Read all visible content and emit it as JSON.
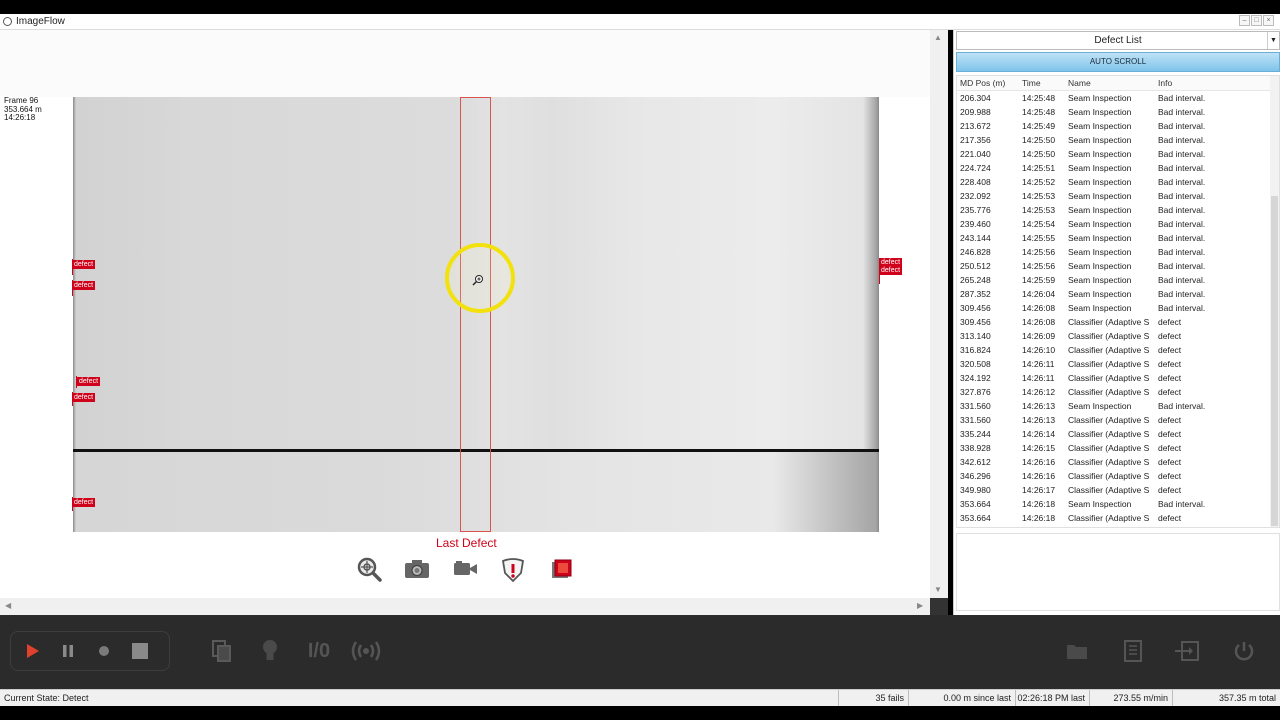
{
  "window": {
    "title": "ImageFlow"
  },
  "frame_info": {
    "frame": "Frame 96",
    "position": "353.664 m",
    "time": "14:26:18"
  },
  "image": {
    "defect_label": "defect",
    "last_defect_label": "Last Defect"
  },
  "toolbar_icons": [
    "zoom-icon",
    "camera-icon",
    "video-camera-icon",
    "defect-alert-icon",
    "stop-overlay-icon"
  ],
  "defect_list": {
    "dropdown_value": "Defect List",
    "auto_scroll_label": "AUTO SCROLL",
    "columns": [
      "MD Pos (m)",
      "Time",
      "Name",
      "Info"
    ],
    "rows": [
      [
        "206.304",
        "14:25:48",
        "Seam Inspection",
        "Bad interval."
      ],
      [
        "209.988",
        "14:25:48",
        "Seam Inspection",
        "Bad interval."
      ],
      [
        "213.672",
        "14:25:49",
        "Seam Inspection",
        "Bad interval."
      ],
      [
        "217.356",
        "14:25:50",
        "Seam Inspection",
        "Bad interval."
      ],
      [
        "221.040",
        "14:25:50",
        "Seam Inspection",
        "Bad interval."
      ],
      [
        "224.724",
        "14:25:51",
        "Seam Inspection",
        "Bad interval."
      ],
      [
        "228.408",
        "14:25:52",
        "Seam Inspection",
        "Bad interval."
      ],
      [
        "232.092",
        "14:25:53",
        "Seam Inspection",
        "Bad interval."
      ],
      [
        "235.776",
        "14:25:53",
        "Seam Inspection",
        "Bad interval."
      ],
      [
        "239.460",
        "14:25:54",
        "Seam Inspection",
        "Bad interval."
      ],
      [
        "243.144",
        "14:25:55",
        "Seam Inspection",
        "Bad interval."
      ],
      [
        "246.828",
        "14:25:56",
        "Seam Inspection",
        "Bad interval."
      ],
      [
        "250.512",
        "14:25:56",
        "Seam Inspection",
        "Bad interval."
      ],
      [
        "265.248",
        "14:25:59",
        "Seam Inspection",
        "Bad interval."
      ],
      [
        "287.352",
        "14:26:04",
        "Seam Inspection",
        "Bad interval."
      ],
      [
        "309.456",
        "14:26:08",
        "Seam Inspection",
        "Bad interval."
      ],
      [
        "309.456",
        "14:26:08",
        "Classifier (Adaptive S",
        "defect"
      ],
      [
        "313.140",
        "14:26:09",
        "Classifier (Adaptive S",
        "defect"
      ],
      [
        "316.824",
        "14:26:10",
        "Classifier (Adaptive S",
        "defect"
      ],
      [
        "320.508",
        "14:26:11",
        "Classifier (Adaptive S",
        "defect"
      ],
      [
        "324.192",
        "14:26:11",
        "Classifier (Adaptive S",
        "defect"
      ],
      [
        "327.876",
        "14:26:12",
        "Classifier (Adaptive S",
        "defect"
      ],
      [
        "331.560",
        "14:26:13",
        "Seam Inspection",
        "Bad interval."
      ],
      [
        "331.560",
        "14:26:13",
        "Classifier (Adaptive S",
        "defect"
      ],
      [
        "335.244",
        "14:26:14",
        "Classifier (Adaptive S",
        "defect"
      ],
      [
        "338.928",
        "14:26:15",
        "Classifier (Adaptive S",
        "defect"
      ],
      [
        "342.612",
        "14:26:16",
        "Classifier (Adaptive S",
        "defect"
      ],
      [
        "346.296",
        "14:26:16",
        "Classifier (Adaptive S",
        "defect"
      ],
      [
        "349.980",
        "14:26:17",
        "Classifier (Adaptive S",
        "defect"
      ],
      [
        "353.664",
        "14:26:18",
        "Seam Inspection",
        "Bad interval."
      ],
      [
        "353.664",
        "14:26:18",
        "Classifier (Adaptive S",
        "defect"
      ]
    ]
  },
  "controls": {
    "media": [
      "play-icon",
      "pause-icon",
      "record-icon",
      "stop-icon"
    ],
    "tools": [
      "copy-icon",
      "lightbulb-icon",
      "io-icon",
      "broadcast-icon"
    ],
    "right_tools": [
      "folder-icon",
      "report-icon",
      "export-icon",
      "power-icon"
    ],
    "io_label": "I/0",
    "accent_play": "#e0412c"
  },
  "status": {
    "state": "Current State: Detect",
    "fails": "35 fails",
    "since_last": "0.00 m since last",
    "last_time": "02:26:18 PM last",
    "speed": "273.55 m/min",
    "total": "357.35 m total"
  }
}
